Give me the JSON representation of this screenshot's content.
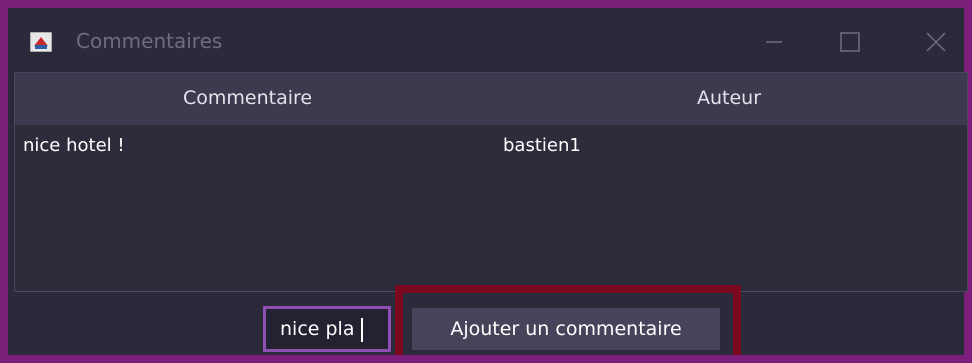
{
  "window": {
    "title": "Commentaires",
    "controls": [
      "minimize",
      "maximize",
      "close"
    ]
  },
  "table": {
    "columns": [
      "Commentaire",
      "Auteur"
    ],
    "rows": [
      {
        "comment": "nice hotel !",
        "author": "bastien1"
      }
    ]
  },
  "form": {
    "input_value": "nice pla",
    "submit_label": "Ajouter un commentaire"
  },
  "colors": {
    "window_border": "#7b1f7b",
    "highlight": "#7a0820",
    "input_focus": "#8d4fb1",
    "header_bg": "#3b3a4e",
    "body_bg": "#2b2a3a"
  },
  "icons": {
    "app": "java-app-icon",
    "minimize": "minimize-icon",
    "maximize": "maximize-icon",
    "close": "close-icon"
  }
}
